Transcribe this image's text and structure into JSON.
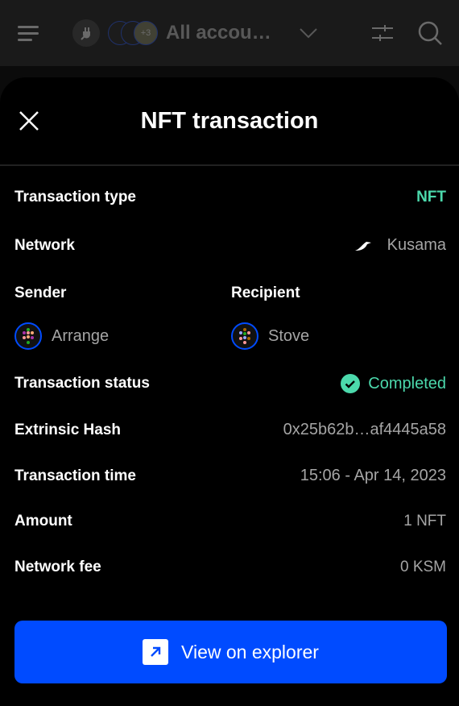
{
  "header": {
    "account_label": "All accou…",
    "extra_count": "+3"
  },
  "modal": {
    "title": "NFT transaction"
  },
  "rows": {
    "type": {
      "label": "Transaction type",
      "value": "NFT"
    },
    "network": {
      "label": "Network",
      "value": "Kusama"
    },
    "sender": {
      "label": "Sender",
      "value": "Arrange"
    },
    "recipient": {
      "label": "Recipient",
      "value": "Stove"
    },
    "status": {
      "label": "Transaction status",
      "value": "Completed"
    },
    "hash": {
      "label": "Extrinsic Hash",
      "value": "0x25b62b…af4445a58"
    },
    "time": {
      "label": "Transaction time",
      "value": "15:06 - Apr 14, 2023"
    },
    "amount": {
      "label": "Amount",
      "value": "1 NFT"
    },
    "fee": {
      "label": "Network fee",
      "value": "0 KSM"
    }
  },
  "button": {
    "label": "View on explorer"
  },
  "colors": {
    "accent": "#004bff",
    "success": "#4cd9ac"
  }
}
